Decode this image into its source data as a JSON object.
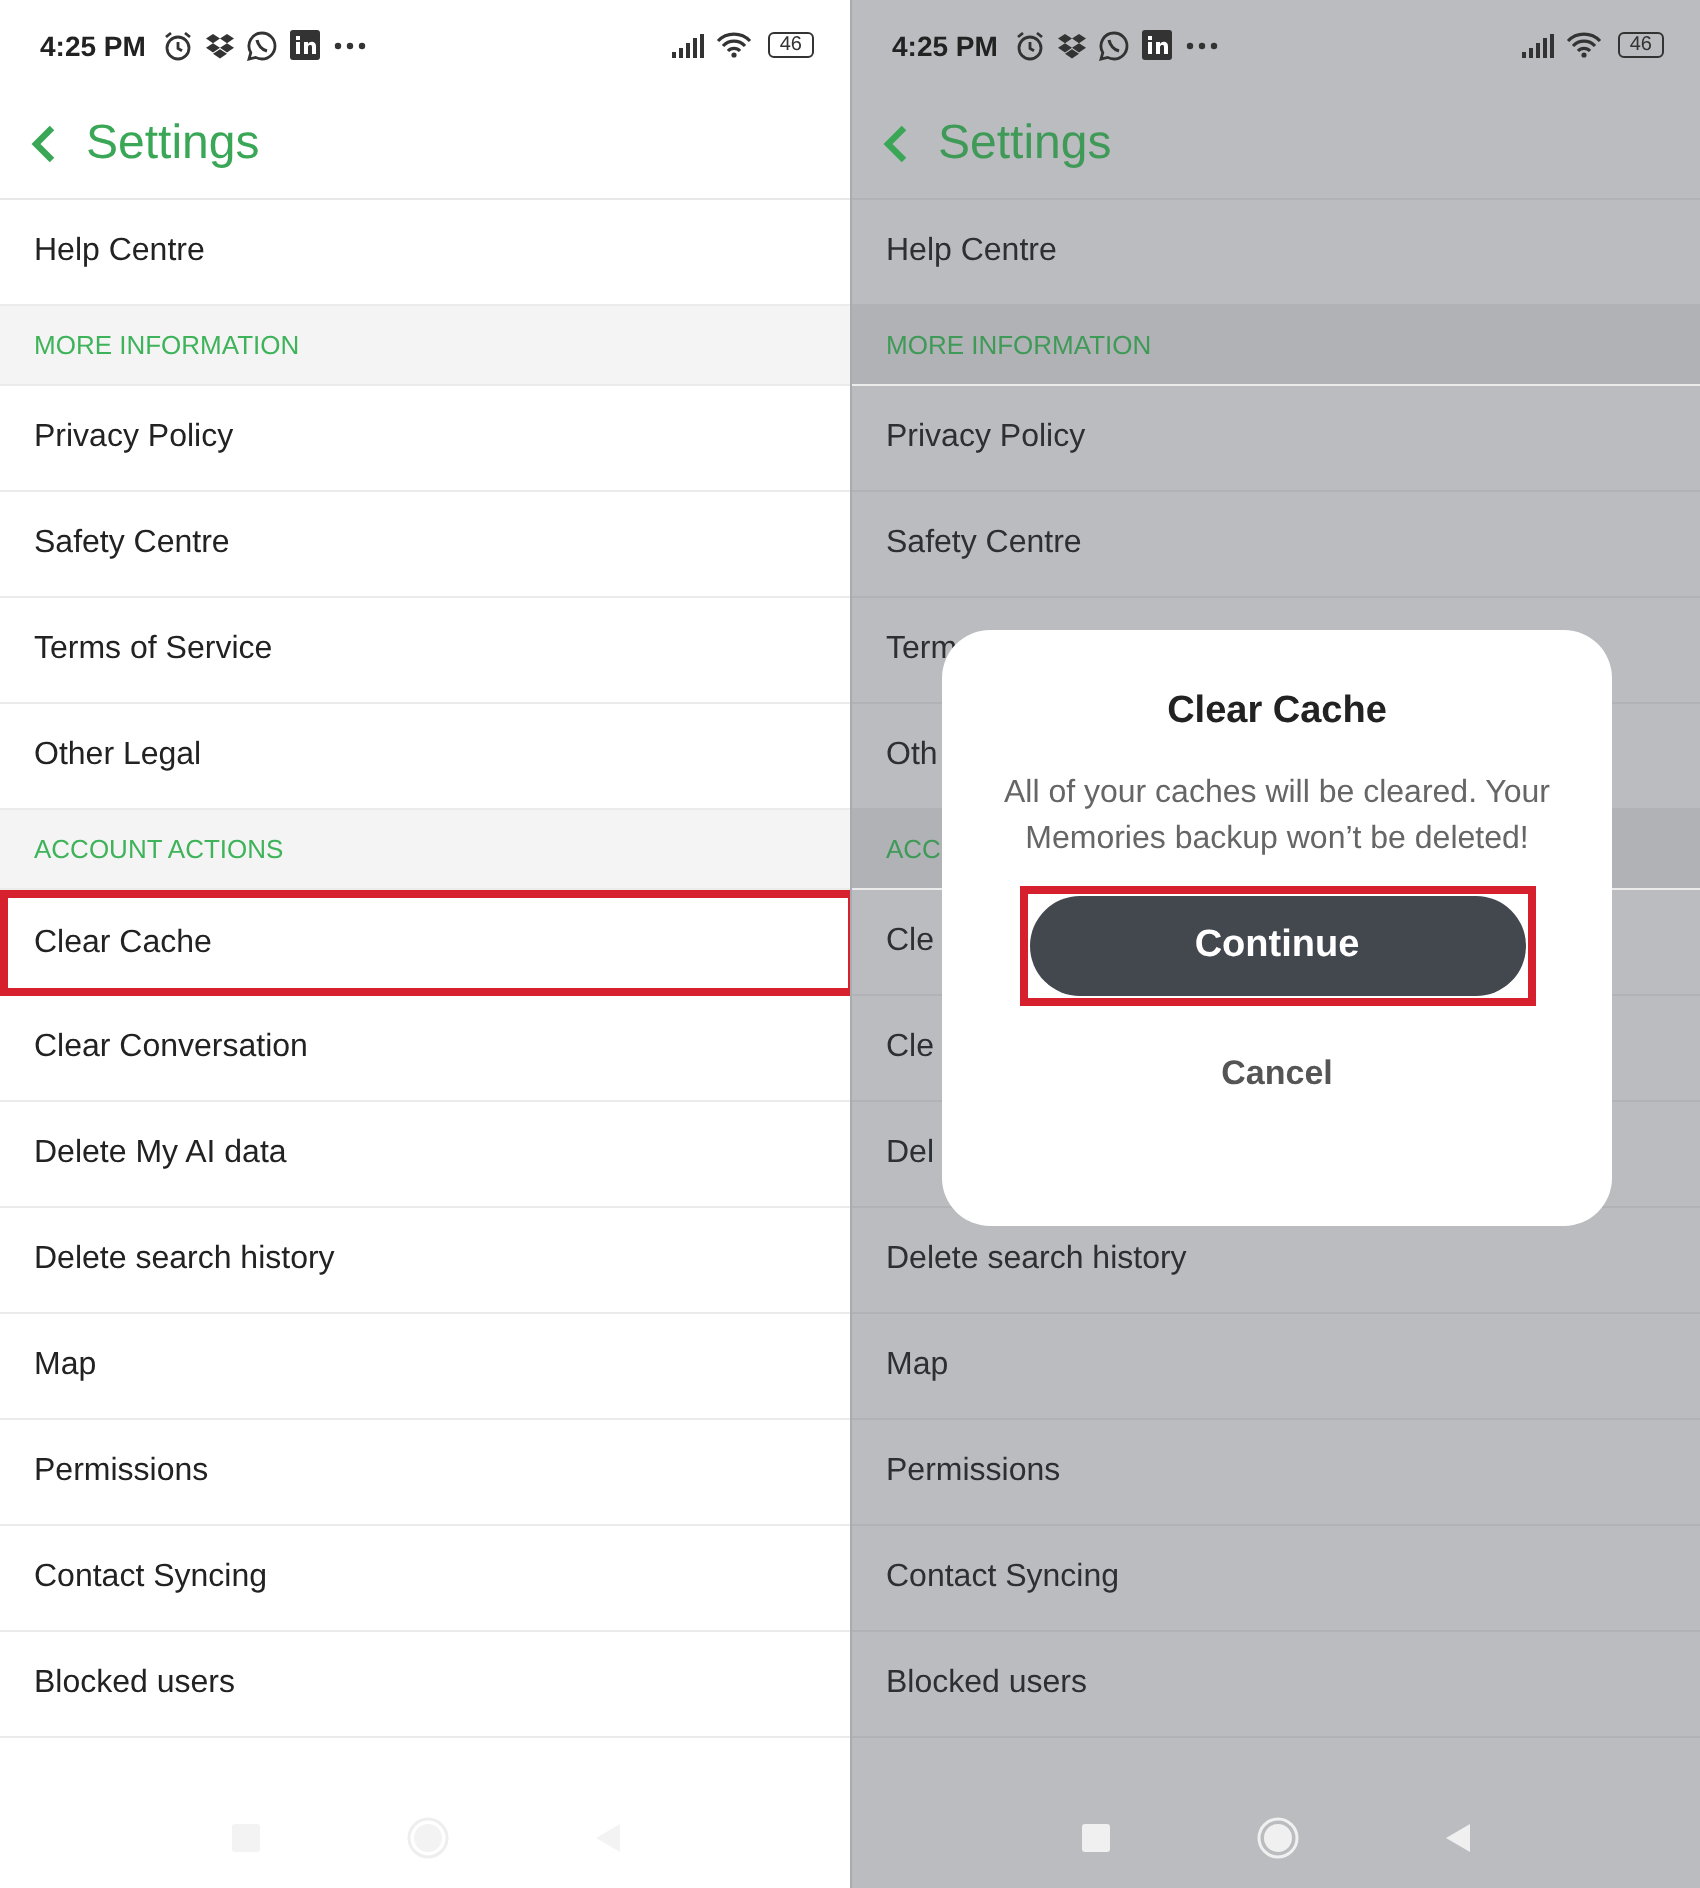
{
  "panels": [
    {
      "dimmed": false,
      "status_bar": {
        "time": "4:25 PM",
        "battery": "46"
      },
      "header": {
        "title": "Settings"
      },
      "rows": [
        {
          "kind": "item",
          "label": "Help Centre",
          "highlighted": false
        },
        {
          "kind": "section",
          "label": "MORE INFORMATION",
          "highlighted": false
        },
        {
          "kind": "item",
          "label": "Privacy Policy",
          "highlighted": false
        },
        {
          "kind": "item",
          "label": "Safety Centre",
          "highlighted": false
        },
        {
          "kind": "item",
          "label": "Terms of Service",
          "highlighted": false
        },
        {
          "kind": "item",
          "label": "Other Legal",
          "highlighted": false
        },
        {
          "kind": "section",
          "label": "ACCOUNT ACTIONS",
          "highlighted": false
        },
        {
          "kind": "item",
          "label": "Clear Cache",
          "highlighted": true
        },
        {
          "kind": "item",
          "label": "Clear Conversation",
          "highlighted": false
        },
        {
          "kind": "item",
          "label": "Delete My AI data",
          "highlighted": false
        },
        {
          "kind": "item",
          "label": "Delete search history",
          "highlighted": false
        },
        {
          "kind": "item",
          "label": "Map",
          "highlighted": false
        },
        {
          "kind": "item",
          "label": "Permissions",
          "highlighted": false
        },
        {
          "kind": "item",
          "label": "Contact Syncing",
          "highlighted": false
        },
        {
          "kind": "item",
          "label": "Blocked users",
          "highlighted": false
        }
      ]
    },
    {
      "dimmed": true,
      "status_bar": {
        "time": "4:25 PM",
        "battery": "46"
      },
      "header": {
        "title": "Settings"
      },
      "rows": [
        {
          "kind": "item",
          "label": "Help Centre",
          "highlighted": false
        },
        {
          "kind": "section",
          "label": "MORE INFORMATION",
          "highlighted": false
        },
        {
          "kind": "item",
          "label": "Privacy Policy",
          "highlighted": false
        },
        {
          "kind": "item",
          "label": "Safety Centre",
          "highlighted": false
        },
        {
          "kind": "item",
          "label": "Term",
          "highlighted": false
        },
        {
          "kind": "item",
          "label": "Oth",
          "highlighted": false
        },
        {
          "kind": "section",
          "label": "ACC",
          "highlighted": false
        },
        {
          "kind": "item",
          "label": "Cle",
          "highlighted": false
        },
        {
          "kind": "item",
          "label": "Cle",
          "highlighted": false
        },
        {
          "kind": "item",
          "label": "Del",
          "highlighted": false
        },
        {
          "kind": "item",
          "label": "Delete search history",
          "highlighted": false
        },
        {
          "kind": "item",
          "label": "Map",
          "highlighted": false
        },
        {
          "kind": "item",
          "label": "Permissions",
          "highlighted": false
        },
        {
          "kind": "item",
          "label": "Contact Syncing",
          "highlighted": false
        },
        {
          "kind": "item",
          "label": "Blocked users",
          "highlighted": false
        }
      ],
      "dialog": {
        "title": "Clear Cache",
        "message": "All of your caches will be cleared. Your Memories backup won’t be deleted!",
        "buttons": [
          {
            "kind": "primary",
            "label": "Continue",
            "highlighted": true
          },
          {
            "kind": "text",
            "label": "Cancel",
            "highlighted": false
          }
        ]
      }
    }
  ]
}
